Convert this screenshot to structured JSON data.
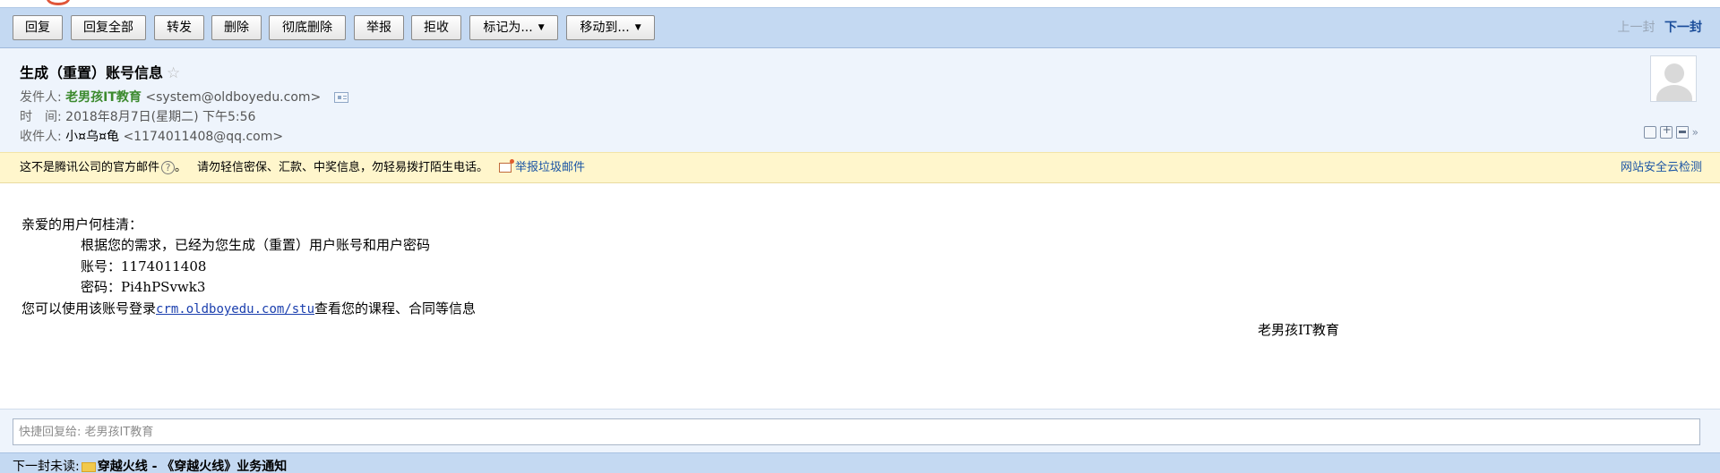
{
  "toolbar": {
    "buttons": [
      {
        "label": "回复"
      },
      {
        "label": "回复全部"
      },
      {
        "label": "转发"
      },
      {
        "label": "删除"
      },
      {
        "label": "彻底删除"
      },
      {
        "label": "举报"
      },
      {
        "label": "拒收"
      },
      {
        "label": "标记为..."
      },
      {
        "label": "移动到..."
      }
    ],
    "prev_label": "上一封",
    "next_label": "下一封"
  },
  "email": {
    "subject": "生成（重置）账号信息",
    "star": "☆",
    "sender_label": "发件人:",
    "sender_name": "老男孩IT教育",
    "sender_email": "<system@oldboyedu.com>",
    "time_label": "时　间:",
    "time_value": "2018年8月7日(星期二) 下午5:56",
    "recipient_label": "收件人:",
    "recipient_name": "小¤乌¤龟",
    "recipient_email": "<1174011408@qq.com>"
  },
  "warning": {
    "text": "这不是腾讯公司的官方邮件",
    "question": "?",
    "period": "。",
    "advice": "请勿轻信密保、汇款、中奖信息，勿轻易拨打陌生电话。",
    "report_label": "举报垃圾邮件",
    "cloud_check": "网站安全云检测"
  },
  "body": {
    "greeting": "亲爱的用户何桂清：",
    "line1": "根据您的需求，已经为您生成（重置）用户账号和用户密码",
    "account": "账号：1174011408",
    "password": "密码：Pi4hPSvwk3",
    "login_prefix": "您可以使用该账号登录",
    "login_link": "crm.oldboyedu.com/stu",
    "login_suffix": "查看您的课程、合同等信息",
    "signature": "老男孩IT教育"
  },
  "quick_reply": {
    "placeholder": "快捷回复给: 老男孩IT教育"
  },
  "next_mail": {
    "label": "下一封未读:",
    "subject": "穿越火线 - 《穿越火线》业务通知"
  }
}
